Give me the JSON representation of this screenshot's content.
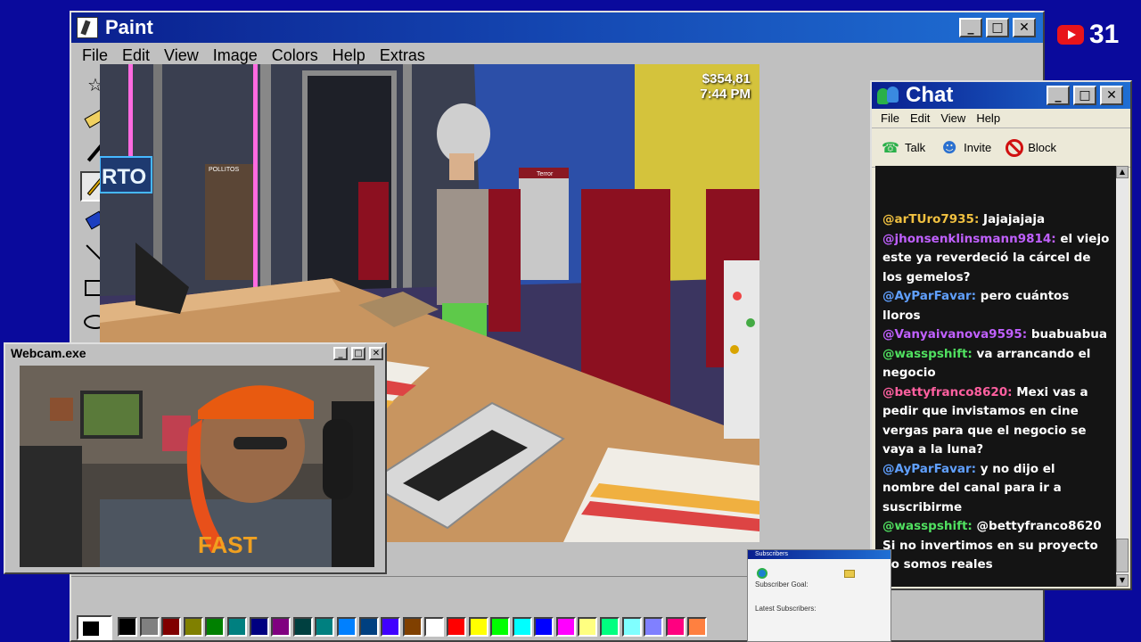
{
  "paint": {
    "title": "Paint",
    "menu": [
      "File",
      "Edit",
      "View",
      "Image",
      "Colors",
      "Help",
      "Extras"
    ],
    "palette": [
      "#000000",
      "#808080",
      "#800000",
      "#808000",
      "#008000",
      "#008080",
      "#000080",
      "#800080",
      "#004040",
      "#008080",
      "#0080ff",
      "#004080",
      "#4000ff",
      "#804000",
      "#ffffff",
      "#ff0000",
      "#ffff00",
      "#00ff00",
      "#00ffff",
      "#0000ff",
      "#ff00ff",
      "#ffff80",
      "#00ff80",
      "#80ffff",
      "#8080ff",
      "#ff0080",
      "#ff8040"
    ]
  },
  "game": {
    "money": "$354,81",
    "time": "7:44 PM",
    "sign": "RTO",
    "shelf_label_1": "POLLITOS",
    "shelf_label_2": "Terror"
  },
  "youtube": {
    "count": "31"
  },
  "chat": {
    "title": "Chat",
    "menu": [
      "File",
      "Edit",
      "View",
      "Help"
    ],
    "tools": {
      "talk": "Talk",
      "invite": "Invite",
      "block": "Block"
    },
    "messages": [
      {
        "user": "@arTUro7935:",
        "text": "Jajajajaja",
        "color": "#f0c040"
      },
      {
        "user": "@jhonsenklinsmann9814:",
        "text": "el viejo este ya reverdeció la cárcel de los gemelos?",
        "color": "#c060ff"
      },
      {
        "user": "@AyParFavar:",
        "text": "pero cuántos lloros",
        "color": "#60a0ff"
      },
      {
        "user": "@Vanyaivanova9595:",
        "text": "buabuabua",
        "color": "#c060ff"
      },
      {
        "user": "@wasspshift:",
        "text": "va arrancando el negocio",
        "color": "#50e060"
      },
      {
        "user": "@bettyfranco8620:",
        "text": "Mexi vas a pedir que invistamos en cine vergas para que el negocio se vaya a la luna?",
        "color": "#ff60a0"
      },
      {
        "user": "@AyParFavar:",
        "text": "y no dijo el nombre del canal para ir a suscribirme",
        "color": "#60a0ff"
      },
      {
        "user": "@wasspshift:",
        "text": "@bettyfranco8620 Si no invertimos en su proyecto no somos reales",
        "color": "#50e060"
      }
    ]
  },
  "webcam": {
    "title": "Webcam.exe",
    "shirt_text": "FAST"
  },
  "subscribers": {
    "title": "Subscribers",
    "goal_label": "Subscriber Goal:",
    "latest_label": "Latest Subscribers:"
  }
}
